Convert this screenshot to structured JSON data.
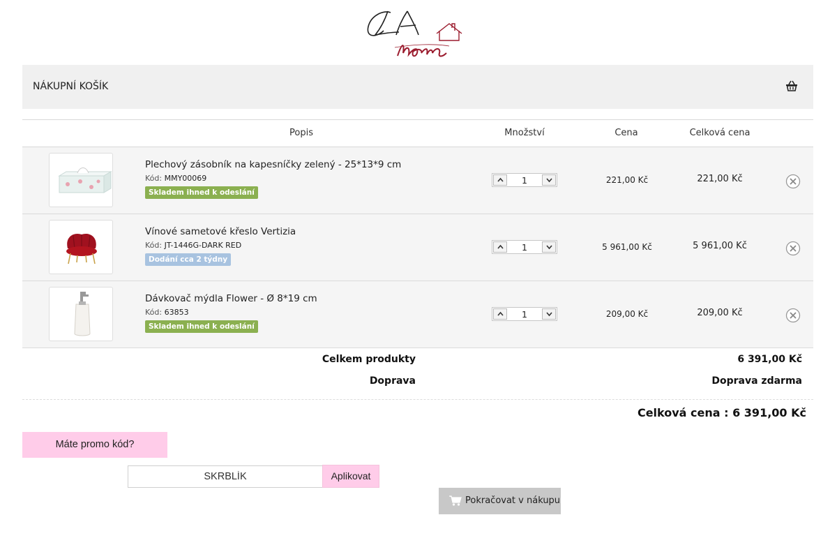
{
  "logo": {
    "brand": "LA home"
  },
  "cart": {
    "title": "NÁKUPNÍ KOŠÍK"
  },
  "table": {
    "headers": {
      "description": "Popis",
      "quantity": "Množství",
      "price": "Cena",
      "total": "Celková cena"
    }
  },
  "items": [
    {
      "name": "Plechový zásobník na kapesníčky zelený - 25*13*9 cm",
      "code_label": "Kód:",
      "code": "MMY00069",
      "availability": "Skladem ihned k odeslání",
      "availability_color": "#8bb050",
      "quantity": "1",
      "price": "221,00 Kč",
      "total": "221,00 Kč"
    },
    {
      "name": "Vínové sametové křeslo Vertizia",
      "code_label": "Kód:",
      "code": "JT-1446G-DARK RED",
      "availability": "Dodání cca 2 týdny",
      "availability_color": "#a8c3e0",
      "quantity": "1",
      "price": "5 961,00 Kč",
      "total": "5 961,00 Kč"
    },
    {
      "name": "Dávkovač mýdla Flower - Ø 8*19 cm",
      "code_label": "Kód:",
      "code": "63853",
      "availability": "Skladem ihned k odeslání",
      "availability_color": "#8bb050",
      "quantity": "1",
      "price": "209,00 Kč",
      "total": "209,00 Kč"
    }
  ],
  "summary": {
    "products_label": "Celkem produkty",
    "products_value": "6 391,00 Kč",
    "shipping_label": "Doprava",
    "shipping_value": "Doprava zdarma",
    "grand_total": "Celková cena : 6 391,00 Kč"
  },
  "promo": {
    "toggle_label": "Máte promo kód?",
    "input_value": "SKRBLÍK",
    "apply_label": "Aplikovat"
  },
  "continue": {
    "label": "Pokračovat v nákupu"
  },
  "colors": {
    "promo_pink": "#ffcce9",
    "header_grey": "#f0f0f0",
    "logo_red": "#9b1c2e"
  }
}
